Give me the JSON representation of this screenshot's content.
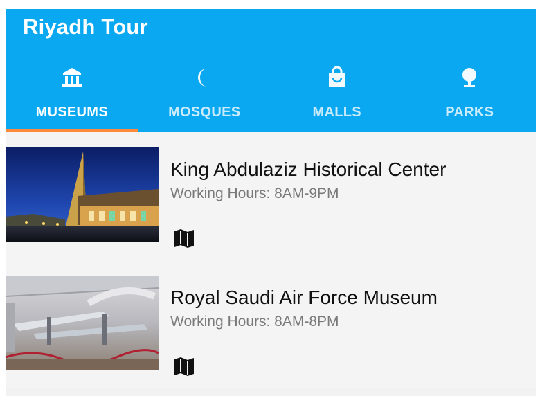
{
  "app": {
    "title": "Riyadh Tour"
  },
  "tabs": [
    {
      "label": "MUSEUMS",
      "icon": "museum-icon",
      "active": true
    },
    {
      "label": "MOSQUES",
      "icon": "crescent-moon-icon",
      "active": false
    },
    {
      "label": "MALLS",
      "icon": "shopping-bag-icon",
      "active": false
    },
    {
      "label": "PARKS",
      "icon": "tree-icon",
      "active": false
    }
  ],
  "places": [
    {
      "name": "King Abdulaziz Historical Center",
      "hours": "Working Hours: 8AM-9PM",
      "image": "king-abdulaziz-center-night-photo",
      "action_icon": "map-icon"
    },
    {
      "name": "Royal Saudi Air Force Museum",
      "hours": "Working Hours: 8AM-8PM",
      "image": "air-force-museum-interior-photo",
      "action_icon": "map-icon"
    }
  ],
  "colors": {
    "app_bar": "#0aa8f0",
    "tab_indicator": "#ff8a3d",
    "list_background": "#f2f2f2"
  }
}
